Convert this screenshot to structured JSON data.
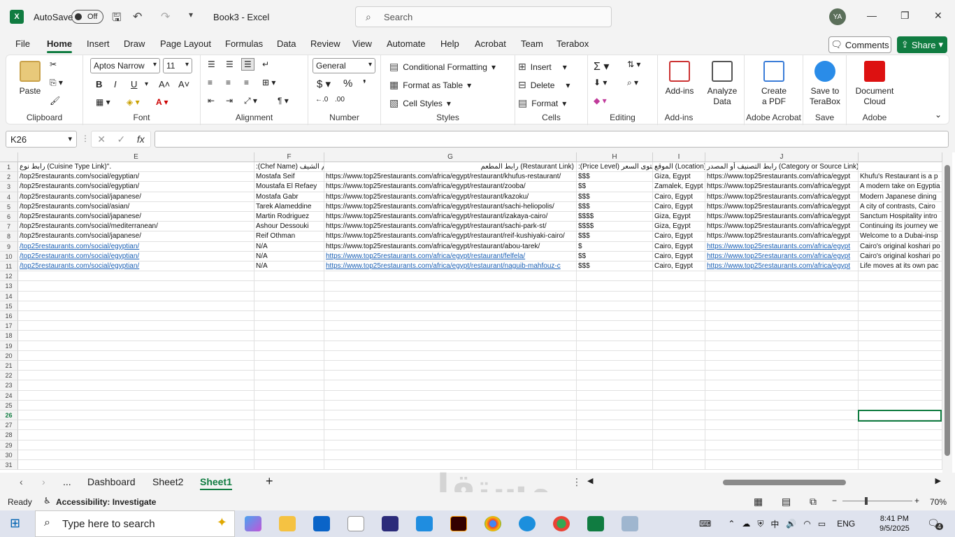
{
  "titlebar": {
    "autosave_label": "AutoSave",
    "autosave_state": "Off",
    "doc_title": "Book3  -  Excel",
    "search_placeholder": "Search",
    "user_initials": "YA"
  },
  "menu": [
    "File",
    "Home",
    "Insert",
    "Draw",
    "Page Layout",
    "Formulas",
    "Data",
    "Review",
    "View",
    "Automate",
    "Help",
    "Acrobat",
    "Team",
    "Terabox"
  ],
  "menu_active": "Home",
  "comments_label": "Comments",
  "share_label": "Share",
  "ribbon": {
    "clipboard": {
      "paste": "Paste",
      "label": "Clipboard"
    },
    "font": {
      "family": "Aptos Narrow",
      "size": "11",
      "bold": "B",
      "italic": "I",
      "underline": "U",
      "label": "Font"
    },
    "alignment": {
      "label": "Alignment"
    },
    "number": {
      "format": "General",
      "label": "Number"
    },
    "styles": {
      "cond": "Conditional Formatting",
      "table": "Format as Table",
      "cell": "Cell Styles",
      "label": "Styles"
    },
    "cells": {
      "insert": "Insert",
      "delete": "Delete",
      "format": "Format",
      "label": "Cells"
    },
    "editing": {
      "label": "Editing"
    },
    "addins": {
      "btn": "Add-ins",
      "label": "Add-ins"
    },
    "analyze": {
      "btn1": "Analyze",
      "btn2": "Data"
    },
    "acrobat": {
      "btn1": "Create",
      "btn2": "a PDF",
      "label": "Adobe Acrobat"
    },
    "save": {
      "btn1": "Save to",
      "btn2": "TeraBox",
      "label": "Save"
    },
    "adobe": {
      "btn1": "Document",
      "btn2": "Cloud",
      "label": "Adobe"
    }
  },
  "formula": {
    "name_box": "K26",
    "content": ""
  },
  "columns": [
    "E",
    "F",
    "G",
    "H",
    "I",
    "J"
  ],
  "rows": [
    [
      "رابط نوع (Cuisine Type Link)\".",
      ":(Chef Name) اسم الشيف",
      "رابط المطعم (Restaurant Link)",
      ":(Price Level) مستوى السعر",
      "الموقع (Location):",
      "رابط التصنيف أو المصدر (Category or Source Link)",
      ""
    ],
    [
      "/top25restaurants.com/social/egyptian/",
      "Mostafa Seif",
      "https://www.top25restaurants.com/africa/egypt/restaurant/khufus-restaurant/",
      "$$$",
      "Giza, Egypt",
      "https://www.top25restaurants.com/africa/egypt",
      "Khufu's Restaurant is a p"
    ],
    [
      "/top25restaurants.com/social/egyptian/",
      "Moustafa El Refaey",
      "https://www.top25restaurants.com/africa/egypt/restaurant/zooba/",
      "$$",
      "Zamalek, Egypt",
      "https://www.top25restaurants.com/africa/egypt",
      "A modern take on Egyptia"
    ],
    [
      "/top25restaurants.com/social/japanese/",
      "Mostafa Gabr",
      "https://www.top25restaurants.com/africa/egypt/restaurant/kazoku/",
      "$$$",
      "Cairo, Egypt",
      "https://www.top25restaurants.com/africa/egypt",
      "Modern Japanese dining"
    ],
    [
      "/top25restaurants.com/social/asian/",
      "Tarek Alameddine",
      "https://www.top25restaurants.com/africa/egypt/restaurant/sachi-heliopolis/",
      "$$$",
      "Cairo, Egypt",
      "https://www.top25restaurants.com/africa/egypt",
      "A city of contrasts, Cairo"
    ],
    [
      "/top25restaurants.com/social/japanese/",
      "Martin Rodriguez",
      "https://www.top25restaurants.com/africa/egypt/restaurant/izakaya-cairo/",
      "$$$$",
      "Giza, Egypt",
      "https://www.top25restaurants.com/africa/egypt",
      "Sanctum Hospitality intro"
    ],
    [
      "/top25restaurants.com/social/mediterranean/",
      "Ashour Dessouki",
      "https://www.top25restaurants.com/africa/egypt/restaurant/sachi-park-st/",
      "$$$$",
      "Giza, Egypt",
      "https://www.top25restaurants.com/africa/egypt",
      "Continuing its journey we"
    ],
    [
      "/top25restaurants.com/social/japanese/",
      "Reif Othman",
      "https://www.top25restaurants.com/africa/egypt/restaurant/reif-kushiyaki-cairo/",
      "$$$",
      "Cairo, Egypt",
      "https://www.top25restaurants.com/africa/egypt",
      "Welcome to a Dubai-insp"
    ],
    [
      "/top25restaurants.com/social/egyptian/",
      "N/A",
      "https://www.top25restaurants.com/africa/egypt/restaurant/abou-tarek/",
      "$",
      "Cairo, Egypt",
      "https://www.top25restaurants.com/africa/egypt",
      "Cairo's original koshari po"
    ],
    [
      "/top25restaurants.com/social/egyptian/",
      "N/A",
      "https://www.top25restaurants.com/africa/egypt/restaurant/felfela/",
      "$$",
      "Cairo, Egypt",
      "https://www.top25restaurants.com/africa/egypt",
      "Cairo's original koshari po"
    ],
    [
      "/top25restaurants.com/social/egyptian/",
      "N/A",
      "https://www.top25restaurants.com/africa/egypt/restaurant/naguib-mahfouz-c",
      "$$$",
      "Cairo, Egypt",
      "https://www.top25restaurants.com/africa/egypt",
      "Life moves at its own pac"
    ]
  ],
  "link_rows": [
    9,
    10,
    11
  ],
  "row_count": 31,
  "selected_row": 26,
  "sheets": {
    "tabs": [
      "Dashboard",
      "Sheet2",
      "Sheet1"
    ],
    "active": "Sheet1",
    "more": "...",
    "add": "+"
  },
  "status": {
    "ready": "Ready",
    "accessibility": "Accessibility: Investigate",
    "zoom": "70%"
  },
  "taskbar": {
    "search_placeholder": "Type here to search",
    "lang": "ENG",
    "time": "8:41 PM",
    "date": "9/5/2025",
    "notif": "4"
  },
  "watermark": "مستقل",
  "colors": {
    "accent": "#107c41",
    "link": "#1a5fb4"
  }
}
